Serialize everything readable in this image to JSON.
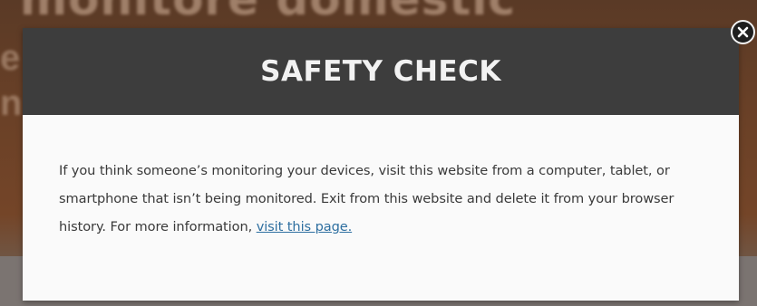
{
  "background": {
    "heading": "monitore domestic",
    "letter_1": "e",
    "letter_2": "n"
  },
  "modal": {
    "title": "SAFETY CHECK",
    "body_text": "If you think someone’s monitoring your devices, visit this website from a computer, tablet, or smartphone that isn’t being monitored. Exit from this website and delete it from your browser history. For more information,",
    "link_text": "visit this page.",
    "close_icon": "close-icon"
  },
  "colors": {
    "header_bg": "#3d3d3d",
    "body_bg": "#fafafa",
    "link": "#2e6fa0",
    "backdrop": "#6a3d22"
  }
}
